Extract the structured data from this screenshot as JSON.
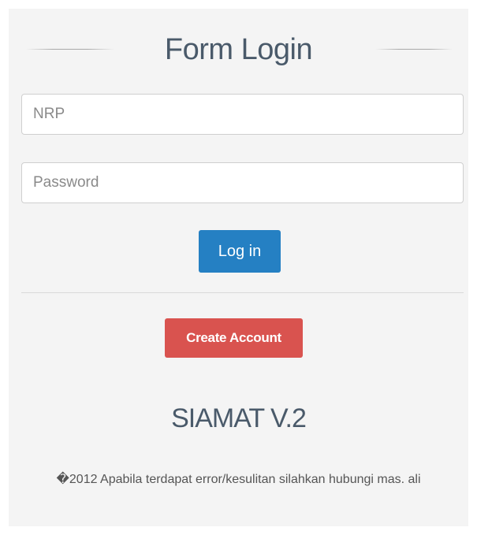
{
  "form": {
    "title": "Form Login",
    "nrp_placeholder": "NRP",
    "nrp_value": "",
    "password_placeholder": "Password",
    "password_value": "",
    "login_label": "Log in",
    "create_account_label": "Create Account"
  },
  "brand": {
    "name": "SIAMAT V.2"
  },
  "footer": {
    "text": "�2012 Apabila terdapat error/kesulitan silahkan hubungi mas. ali"
  },
  "colors": {
    "login_button": "#2580c3",
    "create_button": "#d9534f",
    "panel_background": "#f4f4f4",
    "title_text": "#4a5a6a"
  }
}
